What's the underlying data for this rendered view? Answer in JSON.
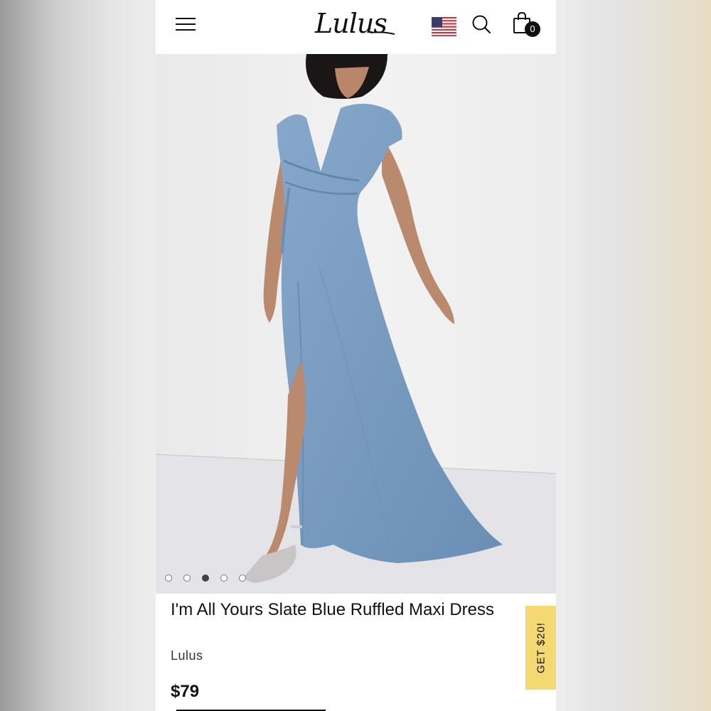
{
  "header": {
    "logo_text": "Lulus",
    "cart_count": "0"
  },
  "product": {
    "title": "I'm All Yours Slate Blue Ruffled Maxi Dress",
    "brand": "Lulus",
    "price": "$79",
    "image_count": 5,
    "active_image_index": 3
  },
  "promo": {
    "label": "GET $20!"
  },
  "colors": {
    "dress": "#7a9cc0",
    "promo_bg": "#f4d872"
  }
}
